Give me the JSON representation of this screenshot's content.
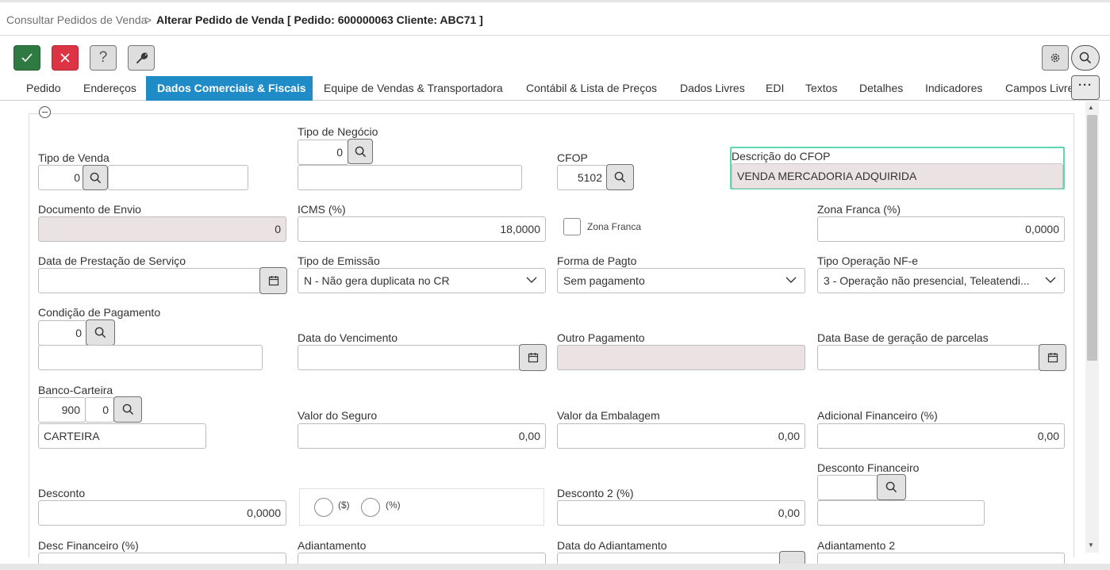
{
  "breadcrumb": {
    "parent": "Consultar Pedidos de Venda",
    "separator": ">",
    "current": "Alterar Pedido de Venda [ Pedido: 600000063 Cliente: ABC71 ]"
  },
  "toolbar": {
    "confirm_icon": "check-icon",
    "cancel_icon": "close-icon",
    "help_label": "?",
    "tools_icon": "wrench-icon",
    "settings_icon": "gear-icon",
    "search_icon": "search-icon"
  },
  "tabs": [
    {
      "label": "Pedido",
      "active": false
    },
    {
      "label": "Endereços",
      "active": false
    },
    {
      "label": "Dados Comerciais & Fiscais",
      "active": true
    },
    {
      "label": "Equipe de Vendas & Transportadora",
      "active": false
    },
    {
      "label": "Contábil & Lista de Preços",
      "active": false
    },
    {
      "label": "Dados Livres",
      "active": false
    },
    {
      "label": "EDI",
      "active": false
    },
    {
      "label": "Textos",
      "active": false
    },
    {
      "label": "Detalhes",
      "active": false
    },
    {
      "label": "Indicadores",
      "active": false
    },
    {
      "label": "Campos Livres",
      "active": false
    }
  ],
  "tabs_more_label": "···",
  "form": {
    "tipo_venda": {
      "label": "Tipo de Venda",
      "code": "0",
      "description": ""
    },
    "tipo_negocio": {
      "label": "Tipo de Negócio",
      "code": "0",
      "description": ""
    },
    "cfop": {
      "label": "CFOP",
      "code": "5102"
    },
    "descricao_cfop": {
      "label": "Descrição do CFOP",
      "value": "VENDA MERCADORIA ADQUIRIDA"
    },
    "documento_envio": {
      "label": "Documento de Envio",
      "value": "0"
    },
    "icms": {
      "label": "ICMS (%)",
      "value": "18,0000"
    },
    "zona_franca_check": {
      "label": "Zona Franca",
      "checked": false
    },
    "zona_franca_pct": {
      "label": "Zona Franca (%)",
      "value": "0,0000"
    },
    "data_prestacao": {
      "label": "Data de Prestação de Serviço",
      "value": ""
    },
    "tipo_emissao": {
      "label": "Tipo de Emissão",
      "value": "N - Não gera duplicata no CR"
    },
    "forma_pagto": {
      "label": "Forma de Pagto",
      "value": "Sem pagamento"
    },
    "tipo_operacao": {
      "label": "Tipo Operação NF-e",
      "value": "3 - Operação não presencial, Teleatendi..."
    },
    "condicao_pagamento": {
      "label": "Condição de Pagamento",
      "code": "0",
      "description": ""
    },
    "data_vencimento": {
      "label": "Data do Vencimento",
      "value": ""
    },
    "outro_pagamento": {
      "label": "Outro Pagamento",
      "value": ""
    },
    "data_base": {
      "label": "Data Base de geração de parcelas",
      "value": ""
    },
    "banco_carteira": {
      "label": "Banco-Carteira",
      "banco": "900",
      "carteira": "0",
      "description": "CARTEIRA"
    },
    "valor_seguro": {
      "label": "Valor do Seguro",
      "value": "0,00"
    },
    "valor_embalagem": {
      "label": "Valor da Embalagem",
      "value": "0,00"
    },
    "adicional_financeiro": {
      "label": "Adicional Financeiro (%)",
      "value": "0,00"
    },
    "desconto_financeiro": {
      "label": "Desconto Financeiro",
      "code": "",
      "description": ""
    },
    "desconto": {
      "label": "Desconto",
      "value": "0,0000"
    },
    "desconto_tipo": {
      "option_money": "($)",
      "option_percent": "(%)"
    },
    "desconto2": {
      "label": "Desconto 2 (%)",
      "value": "0,00"
    },
    "desc_financeiro_pct": {
      "label": "Desc Financeiro (%)"
    },
    "adiantamento": {
      "label": "Adiantamento"
    },
    "data_adiantamento": {
      "label": "Data do Adiantamento"
    },
    "adiantamento2": {
      "label": "Adiantamento 2"
    }
  },
  "colors": {
    "active_tab": "#1f8cc7",
    "confirm": "#2f7a43",
    "cancel": "#dc3444",
    "highlight_border": "#5fd6b1",
    "disabled_field": "#ebe3e3"
  }
}
